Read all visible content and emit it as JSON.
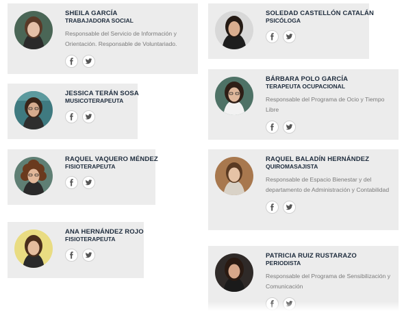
{
  "team": [
    {
      "name": "SHEILA GARCÍA",
      "role": "TRABAJADORA SOCIAL",
      "description": "Responsable del Servicio de Información y Orientación. Responsable de Voluntariado.",
      "social": [
        "facebook-icon",
        "twitter-icon"
      ]
    },
    {
      "name": "SOLEDAD CASTELLÓN CATALÁN",
      "role": "PSICÓLOGA",
      "description": "",
      "social": [
        "facebook-icon",
        "twitter-icon"
      ]
    },
    {
      "name": "JESSICA TERÁN SOSA",
      "role": "MUSICOTERAPEUTA",
      "description": "",
      "social": [
        "facebook-icon",
        "twitter-icon"
      ]
    },
    {
      "name": "BÁRBARA POLO GARCÍA",
      "role": "TERAPEUTA OCUPACIONAL",
      "description": "Responsable del Programa de Ocio y Tiempo Libre",
      "social": [
        "facebook-icon",
        "twitter-icon"
      ]
    },
    {
      "name": "RAQUEL VAQUERO MÉNDEZ",
      "role": "FISIOTERAPEUTA",
      "description": "",
      "social": [
        "facebook-icon",
        "twitter-icon"
      ]
    },
    {
      "name": "RAQUEL BALADÍN HERNÁNDEZ",
      "role": "QUIROMASAJISTA",
      "description": "Responsable de Espacio Bienestar y del departamento de Administración y Contabilidad",
      "social": [
        "facebook-icon",
        "twitter-icon"
      ]
    },
    {
      "name": "ANA HERNÁNDEZ ROJO",
      "role": "FISIOTERAPEUTA",
      "description": "",
      "social": [
        "facebook-icon",
        "twitter-icon"
      ]
    },
    {
      "name": "PATRICIA RUIZ RUSTARAZO",
      "role": "PERIODISTA",
      "description": "Responsable del Programa de Sensibilización y Comunicación",
      "social": [
        "facebook-icon",
        "twitter-icon"
      ]
    }
  ],
  "colors": {
    "card_background": "#ececec",
    "name_text": "#1e2c3d",
    "description_text": "#7a7a7a"
  }
}
